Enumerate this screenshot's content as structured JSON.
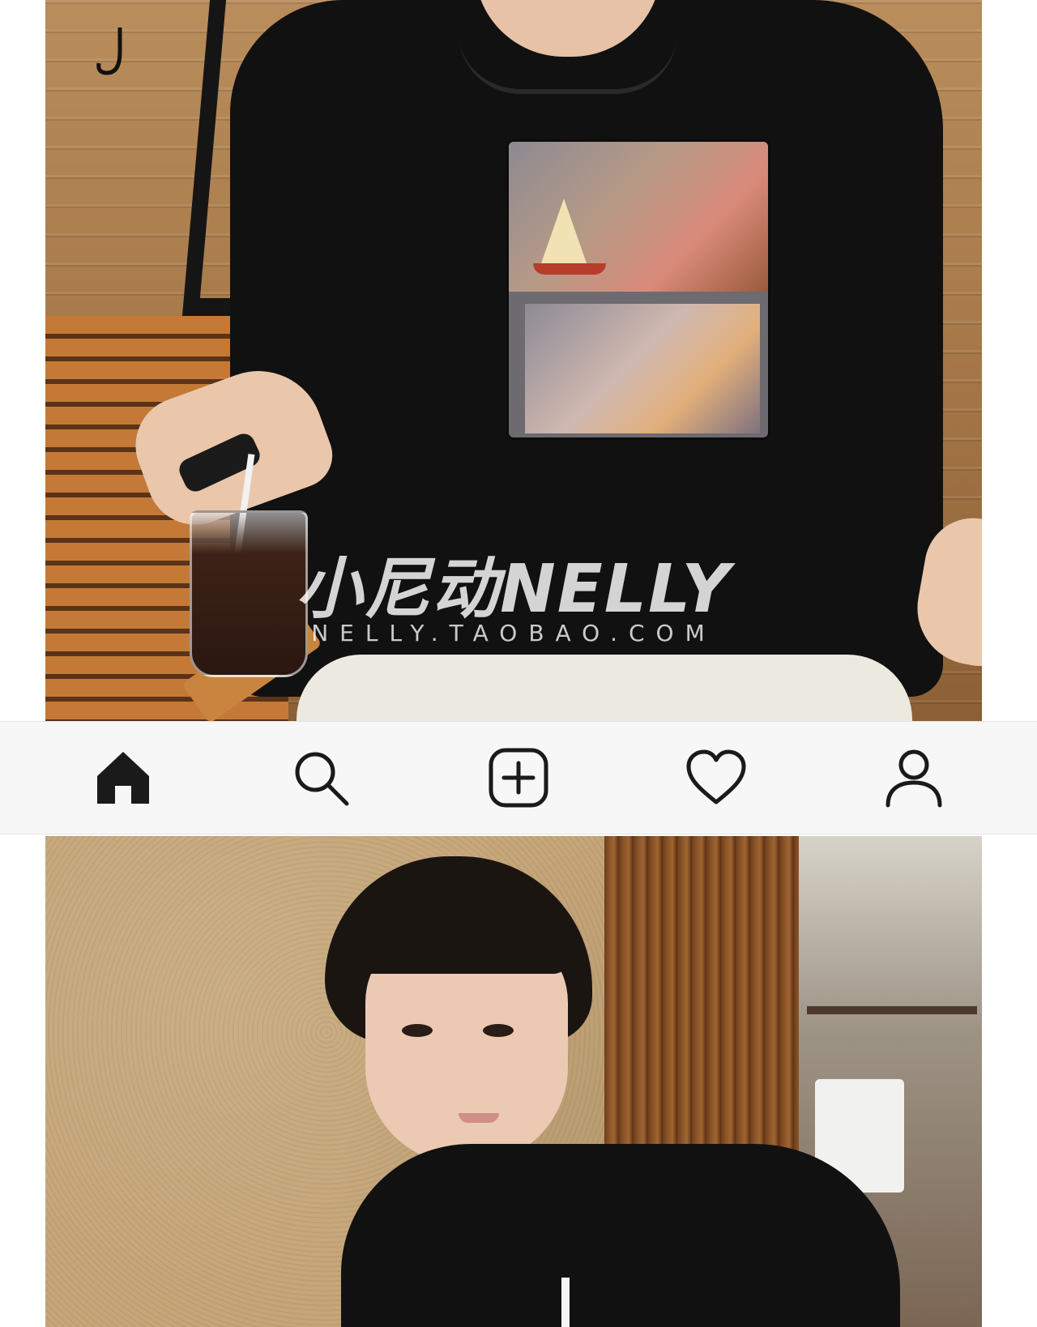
{
  "watermark": {
    "brand": "小尼动NELLY",
    "url": "NELLY.TAOBAO.COM"
  },
  "nav": {
    "items": [
      {
        "name": "Home",
        "icon": "home-icon",
        "active": true
      },
      {
        "name": "Search",
        "icon": "search-icon",
        "active": false
      },
      {
        "name": "Create",
        "icon": "add-square-icon",
        "active": false
      },
      {
        "name": "Activity",
        "icon": "heart-icon",
        "active": false
      },
      {
        "name": "Profile",
        "icon": "profile-icon",
        "active": false
      }
    ],
    "icon_color": "#1a1a1a",
    "background": "#f7f7f7"
  }
}
